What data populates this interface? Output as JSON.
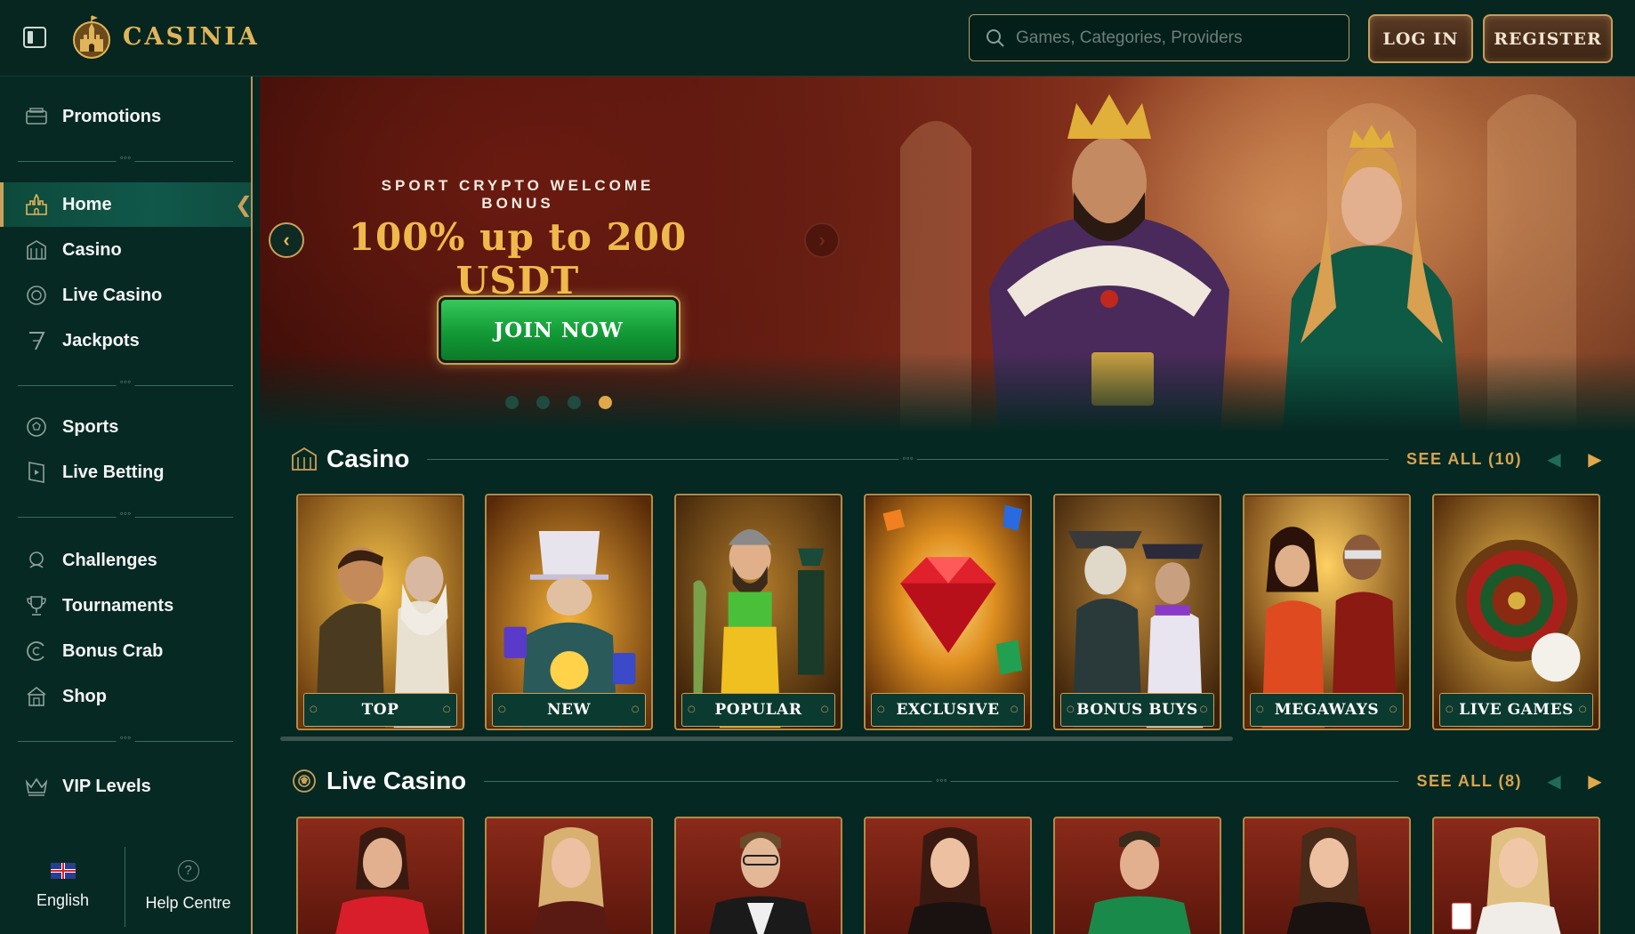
{
  "header": {
    "logo_text": "CASINIA",
    "search_placeholder": "Games, Categories, Providers",
    "login_label": "LOG IN",
    "register_label": "REGISTER"
  },
  "sidebar": {
    "items": [
      {
        "label": "Promotions",
        "icon": "promotions-icon"
      },
      {
        "label": "Home",
        "icon": "home-castle-icon"
      },
      {
        "label": "Casino",
        "icon": "casino-icon"
      },
      {
        "label": "Live Casino",
        "icon": "live-casino-icon"
      },
      {
        "label": "Jackpots",
        "icon": "jackpot-seven-icon"
      },
      {
        "label": "Sports",
        "icon": "sports-ball-icon"
      },
      {
        "label": "Live Betting",
        "icon": "live-betting-icon"
      },
      {
        "label": "Challenges",
        "icon": "challenges-icon"
      },
      {
        "label": "Tournaments",
        "icon": "trophy-icon"
      },
      {
        "label": "Bonus Crab",
        "icon": "bonus-crab-icon"
      },
      {
        "label": "Shop",
        "icon": "shop-icon"
      },
      {
        "label": "VIP Levels",
        "icon": "crown-icon"
      }
    ],
    "language": "English",
    "help": "Help Centre"
  },
  "banner": {
    "kicker": "SPORT CRYPTO WELCOME BONUS",
    "headline": "100% up to 200 USDT",
    "cta": "JOIN NOW",
    "slide_count": 4,
    "active_slide": 4
  },
  "casino_section": {
    "title": "Casino",
    "see_all": "SEE ALL (10)",
    "tiles": [
      {
        "label": "TOP"
      },
      {
        "label": "NEW"
      },
      {
        "label": "POPULAR"
      },
      {
        "label": "EXCLUSIVE"
      },
      {
        "label": "BONUS BUYS"
      },
      {
        "label": "MEGAWAYS"
      },
      {
        "label": "LIVE GAMES"
      }
    ]
  },
  "live_casino_section": {
    "title": "Live Casino",
    "see_all": "SEE ALL (8)"
  },
  "colors": {
    "background": "#062822",
    "accent_gold": "#d7a44f",
    "cta_green": "#129a36"
  }
}
